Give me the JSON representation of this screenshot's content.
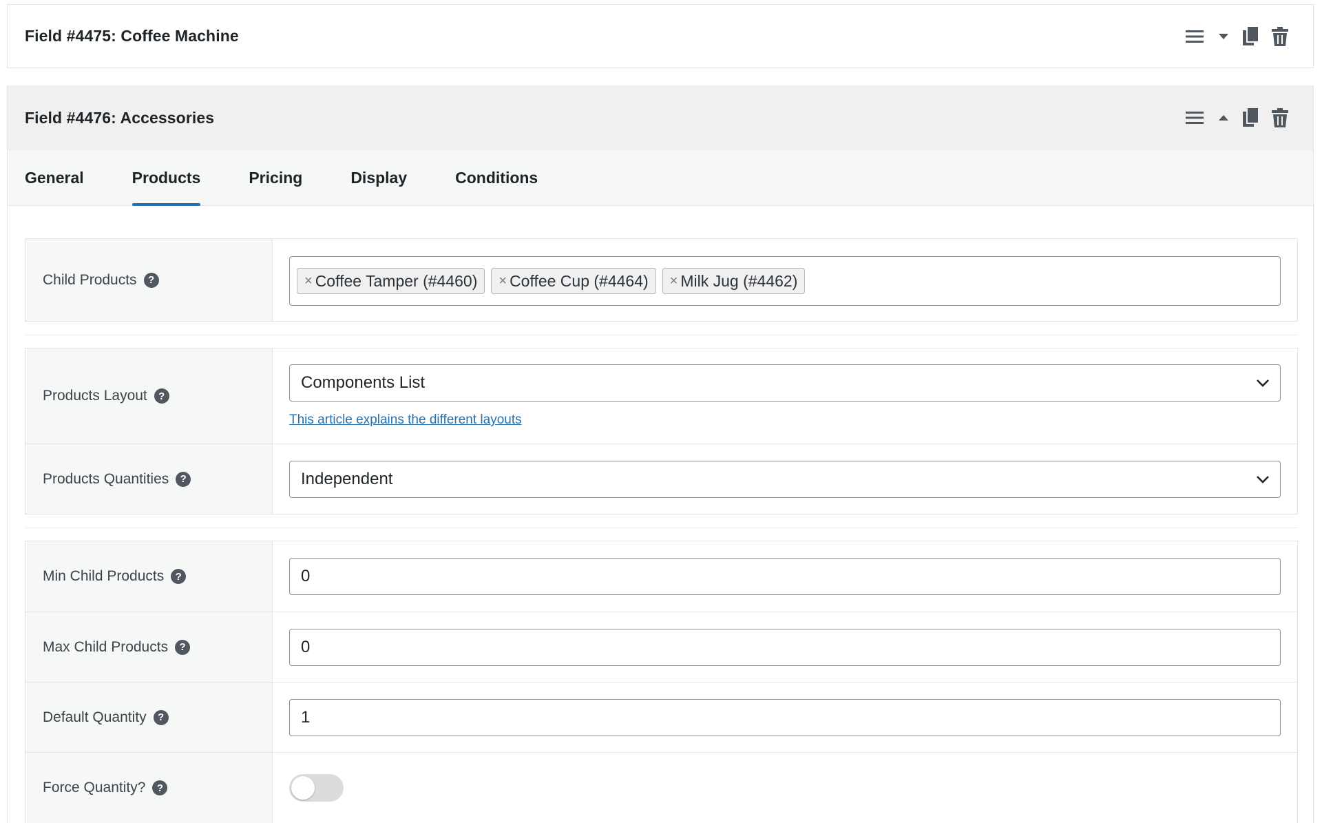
{
  "field_collapsed": {
    "title": "Field #4475: Coffee Machine"
  },
  "field_expanded": {
    "title": "Field #4476: Accessories",
    "tabs": [
      {
        "label": "General"
      },
      {
        "label": "Products"
      },
      {
        "label": "Pricing"
      },
      {
        "label": "Display"
      },
      {
        "label": "Conditions"
      }
    ],
    "active_tab": "Products"
  },
  "settings": {
    "child_products": {
      "label": "Child Products",
      "tags": [
        {
          "label": "Coffee Tamper (#4460)"
        },
        {
          "label": "Coffee Cup (#4464)"
        },
        {
          "label": "Milk Jug (#4462)"
        }
      ],
      "remove_glyph": "×"
    },
    "products_layout": {
      "label": "Products Layout",
      "value": "Components List",
      "link_text": "This article explains the different layouts"
    },
    "products_quantities": {
      "label": "Products Quantities",
      "value": "Independent"
    },
    "min_child_products": {
      "label": "Min Child Products",
      "value": "0"
    },
    "max_child_products": {
      "label": "Max Child Products",
      "value": "0"
    },
    "default_quantity": {
      "label": "Default Quantity",
      "value": "1"
    },
    "force_quantity": {
      "label": "Force Quantity?",
      "enabled": false
    }
  },
  "help_glyph": "?",
  "colors": {
    "accent": "#2271b1",
    "header_bg": "#f0f0f1",
    "label_bg": "#f6f7f7",
    "border": "#e2e4e7",
    "toggle_off": "#dcdcde"
  }
}
